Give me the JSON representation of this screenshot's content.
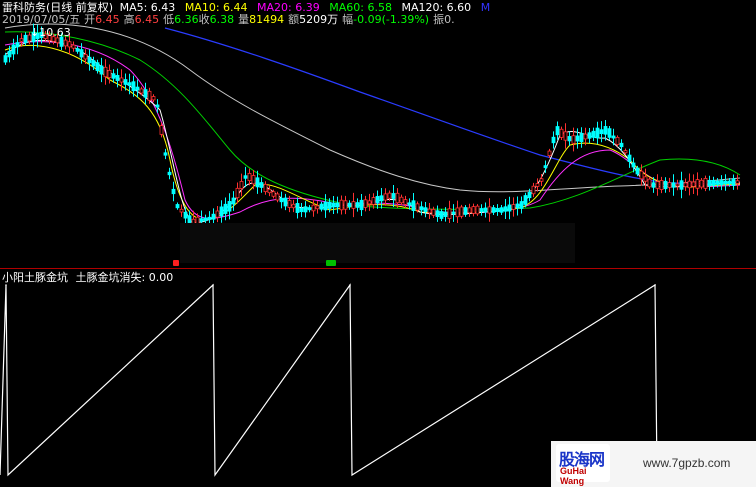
{
  "header": {
    "stock_label": "雷科防务(日线 前复权)",
    "ma": [
      {
        "label": "MA5: 6.43",
        "color": "#ffffff"
      },
      {
        "label": "MA10: 6.44",
        "color": "#ffff00"
      },
      {
        "label": "MA20: 6.39",
        "color": "#ff00ff"
      },
      {
        "label": "MA60: 6.58",
        "color": "#00ff00"
      },
      {
        "label": "MA120: 6.60",
        "color": "#ffffff"
      },
      {
        "label": "M",
        "color": "#3333ff"
      }
    ]
  },
  "info_line": {
    "date": "2019/07/05/五",
    "open_label": "开",
    "open": "6.45",
    "high_label": "高",
    "high": "6.45",
    "low_label": "低",
    "low": "6.36",
    "close_label": "收",
    "close": "6.38",
    "vol_label": "量",
    "vol": "81494",
    "amount_label": "额",
    "amount": "5209万",
    "change_label": "幅",
    "change": "-0.09(-1.39%)",
    "amp_label": "振",
    "amp": "0."
  },
  "price_marker": "10.63",
  "indicator": {
    "name": "小阳土豚金坑",
    "series_label": "土豚金坑消失: 0.00"
  },
  "watermark": {
    "cn": "股海网",
    "en": "GuHai Wang",
    "url": "www.7gpzb.com"
  },
  "colors": {
    "background": "#000000",
    "up": "#ff3030",
    "down": "#00ffff",
    "divider": "#b00000"
  },
  "chart_data": {
    "type": "line",
    "title": "",
    "ylim": [
      0,
      1
    ],
    "series": [
      {
        "name": "土豚金坑消失",
        "values": [
          0,
          1,
          0,
          1,
          0,
          1,
          0,
          1,
          0
        ],
        "x": [
          0,
          6,
          8,
          213,
          215,
          350,
          352,
          655,
          657
        ]
      }
    ]
  }
}
